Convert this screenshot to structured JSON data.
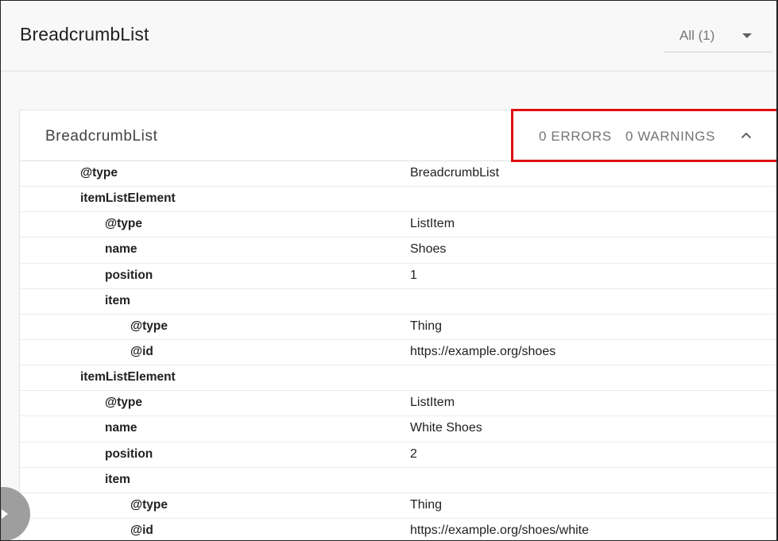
{
  "header": {
    "title": "BreadcrumbList",
    "filter": {
      "selected": "All (1)"
    }
  },
  "card": {
    "title": "BreadcrumbList",
    "errors": "0 ERRORS",
    "warnings": "0 WARNINGS",
    "collapse_icon": "chevron-up-icon"
  },
  "highlight": {
    "color": "#e01010"
  },
  "rows": [
    {
      "key": "@type",
      "value": "BreadcrumbList",
      "depth": 1
    },
    {
      "key": "itemListElement",
      "value": "",
      "depth": 1
    },
    {
      "key": "@type",
      "value": "ListItem",
      "depth": 2
    },
    {
      "key": "name",
      "value": "Shoes",
      "depth": 2
    },
    {
      "key": "position",
      "value": "1",
      "depth": 2
    },
    {
      "key": "item",
      "value": "",
      "depth": 2
    },
    {
      "key": "@type",
      "value": "Thing",
      "depth": 3
    },
    {
      "key": "@id",
      "value": "https://example.org/shoes",
      "depth": 3
    },
    {
      "key": "itemListElement",
      "value": "",
      "depth": 1
    },
    {
      "key": "@type",
      "value": "ListItem",
      "depth": 2
    },
    {
      "key": "name",
      "value": "White Shoes",
      "depth": 2
    },
    {
      "key": "position",
      "value": "2",
      "depth": 2
    },
    {
      "key": "item",
      "value": "",
      "depth": 2
    },
    {
      "key": "@type",
      "value": "Thing",
      "depth": 3
    },
    {
      "key": "@id",
      "value": "https://example.org/shoes/white",
      "depth": 3
    }
  ]
}
